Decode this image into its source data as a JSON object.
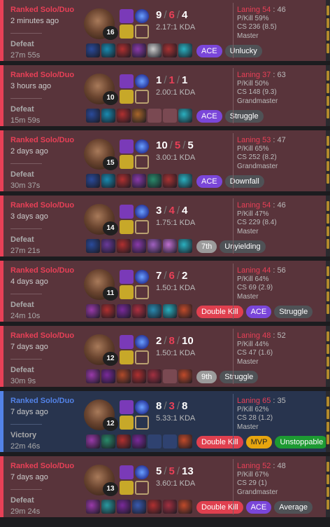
{
  "matches": [
    {
      "queue": "Ranked Solo/Duo",
      "ago": "2 minutes ago",
      "result": "Defeat",
      "duration": "27m 55s",
      "level": "16",
      "kills": "9",
      "deaths": "6",
      "assists": "4",
      "kda": "2.17:1 KDA",
      "laning_label": "Laning 54",
      "laning_val": ": 46",
      "pkill": "P/Kill 59%",
      "cs": "CS 236 (8.5)",
      "rank": "Master",
      "tags": [
        {
          "text": "ACE",
          "type": "ace"
        },
        {
          "text": "Unlucky",
          "type": "grey"
        }
      ],
      "items": [
        "#2a4a9a",
        "#1a8ab0",
        "#b03030",
        "#8a3aaa",
        "#ccc",
        "#a33",
        "#2ab0c0"
      ],
      "win": false
    },
    {
      "queue": "Ranked Solo/Duo",
      "ago": "3 hours ago",
      "result": "Defeat",
      "duration": "15m 59s",
      "level": "10",
      "kills": "1",
      "deaths": "1",
      "assists": "1",
      "kda": "2.00:1 KDA",
      "laning_label": "Laning 37",
      "laning_val": ": 63",
      "pkill": "P/Kill 50%",
      "cs": "CS 148 (9.3)",
      "rank": "Grandmaster",
      "tags": [
        {
          "text": "ACE",
          "type": "ace"
        },
        {
          "text": "Struggle",
          "type": "grey"
        }
      ],
      "items": [
        "#2a4a9a",
        "#1a8ab0",
        "#b03030",
        "#a8652a",
        "empty",
        "empty",
        "#2ab0c0"
      ],
      "win": false
    },
    {
      "queue": "Ranked Solo/Duo",
      "ago": "2 days ago",
      "result": "Defeat",
      "duration": "30m 37s",
      "level": "15",
      "kills": "10",
      "deaths": "5",
      "assists": "5",
      "kda": "3.00:1 KDA",
      "laning_label": "Laning 53",
      "laning_val": ": 47",
      "pkill": "P/Kill 65%",
      "cs": "CS 252 (8.2)",
      "rank": "Grandmaster",
      "tags": [
        {
          "text": "ACE",
          "type": "ace"
        },
        {
          "text": "Downfall",
          "type": "grey"
        }
      ],
      "items": [
        "#2a4a9a",
        "#1a8ab0",
        "#b03030",
        "#8a3aaa",
        "#2a8a6a",
        "#a33",
        "#2ab0c0"
      ],
      "win": false
    },
    {
      "queue": "Ranked Solo/Duo",
      "ago": "3 days ago",
      "result": "Defeat",
      "duration": "27m 21s",
      "level": "14",
      "kills": "3",
      "deaths": "4",
      "assists": "4",
      "kda": "1.75:1 KDA",
      "laning_label": "Laning 54",
      "laning_val": ": 46",
      "pkill": "P/Kill 47%",
      "cs": "CS 229 (8.4)",
      "rank": "Master",
      "tags": [
        {
          "text": "7th",
          "type": "rank"
        },
        {
          "text": "Unyielding",
          "type": "grey"
        }
      ],
      "items": [
        "#2a4a9a",
        "#6a3a9a",
        "#b03030",
        "#8a3aaa",
        "#a060c0",
        "#c070d0",
        "#2ab0c0"
      ],
      "win": false
    },
    {
      "queue": "Ranked Solo/Duo",
      "ago": "4 days ago",
      "result": "Defeat",
      "duration": "24m 10s",
      "level": "11",
      "kills": "7",
      "deaths": "6",
      "assists": "2",
      "kda": "1.50:1 KDA",
      "laning_label": "Laning 44",
      "laning_val": ": 56",
      "pkill": "P/Kill 64%",
      "cs": "CS 69 (2.9)",
      "rank": "Master",
      "tags": [
        {
          "text": "Double Kill",
          "type": "red"
        },
        {
          "text": "ACE",
          "type": "ace"
        },
        {
          "text": "Struggle",
          "type": "grey"
        }
      ],
      "items": [
        "#9a3aaa",
        "#b03030",
        "#7a2a9a",
        "#b03040",
        "#2a8ab0",
        "#2ab0c0",
        "#c04a2a"
      ],
      "win": false
    },
    {
      "queue": "Ranked Solo/Duo",
      "ago": "7 days ago",
      "result": "Defeat",
      "duration": "30m 9s",
      "level": "12",
      "kills": "2",
      "deaths": "8",
      "assists": "10",
      "kda": "1.50:1 KDA",
      "laning_label": "Laning 48",
      "laning_val": ": 52",
      "pkill": "P/Kill 44%",
      "cs": "CS 47 (1.6)",
      "rank": "Master",
      "tags": [
        {
          "text": "9th",
          "type": "rank"
        },
        {
          "text": "Struggle",
          "type": "grey"
        }
      ],
      "items": [
        "#9a3aaa",
        "#7a2a9a",
        "#b04a2a",
        "#b03030",
        "#a33040",
        "empty",
        "#c04a2a"
      ],
      "win": false
    },
    {
      "queue": "Ranked Solo/Duo",
      "ago": "7 days ago",
      "result": "Victory",
      "duration": "22m 46s",
      "level": "12",
      "kills": "8",
      "deaths": "3",
      "assists": "8",
      "kda": "5.33:1 KDA",
      "laning_label": "Laning 65",
      "laning_val": ": 35",
      "pkill": "P/Kill 62%",
      "cs": "CS 28 (1.2)",
      "rank": "Master",
      "tags": [
        {
          "text": "Double Kill",
          "type": "red"
        },
        {
          "text": "MVP",
          "type": "mvp"
        },
        {
          "text": "Unstoppable",
          "type": "green"
        }
      ],
      "items": [
        "#9a3aaa",
        "#2a8a6a",
        "#b03030",
        "#7a2a9a",
        "empty",
        "empty",
        "#c04a2a"
      ],
      "win": true
    },
    {
      "queue": "Ranked Solo/Duo",
      "ago": "7 days ago",
      "result": "Defeat",
      "duration": "29m 24s",
      "level": "13",
      "kills": "5",
      "deaths": "5",
      "assists": "13",
      "kda": "3.60:1 KDA",
      "laning_label": "Laning 52",
      "laning_val": ": 48",
      "pkill": "P/Kill 67%",
      "cs": "CS 29 (1)",
      "rank": "Grandmaster",
      "tags": [
        {
          "text": "Double Kill",
          "type": "red"
        },
        {
          "text": "ACE",
          "type": "ace"
        },
        {
          "text": "Average",
          "type": "grey"
        }
      ],
      "items": [
        "#9a3aaa",
        "#2a9aa0",
        "#7a2a9a",
        "#3a5ab0",
        "#b03030",
        "#a33040",
        "#c04a2a"
      ],
      "win": false
    }
  ],
  "icons": {
    "spell_colors": [
      "#7a3ab8",
      "#2a2a9a"
    ],
    "rune_colors": [
      "#c7a829",
      "#b8a070"
    ]
  }
}
